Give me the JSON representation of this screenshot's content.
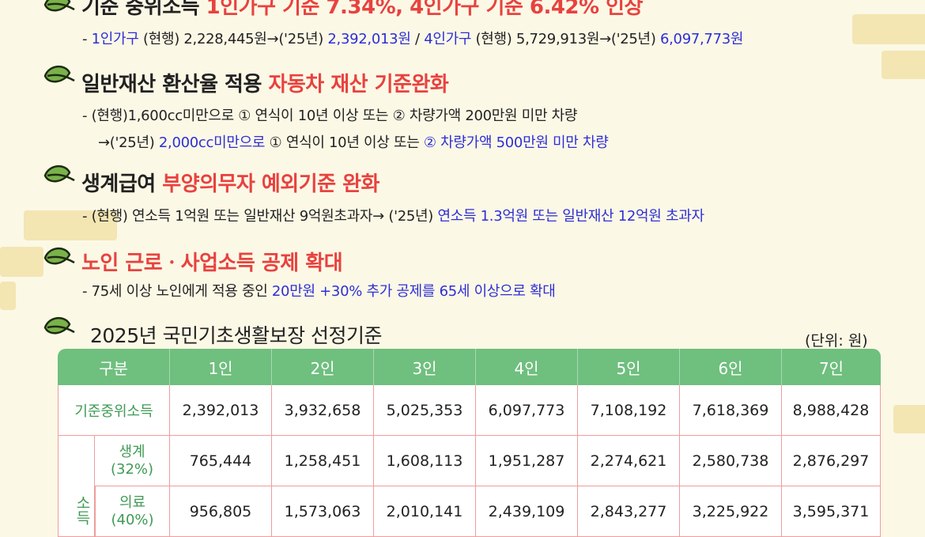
{
  "colors": {
    "red": "#e8423f",
    "blue": "#2d2fd6",
    "green": "#6fbf7e",
    "leaf": "#7ab24a"
  },
  "sec1": {
    "title": "기준 중위소득",
    "title_red": "1인가구 기준 7.34%, 4인가구 기준 6.42% 인상",
    "line": {
      "p1": "- ",
      "p2": "1인가구",
      "p3": " (현행) 2,228,445원→('25년) ",
      "p4": "2,392,013원",
      "p5": " / ",
      "p6": "4인가구",
      "p7": " (현행) 5,729,913원→('25년) ",
      "p8": "6,097,773원"
    }
  },
  "sec2": {
    "title": "일반재산 환산율 적용 ",
    "title_red": "자동차 재산 기준완화",
    "line1": "- (현행)1,600cc미만으로 ① 연식이 10년 이상 또는  ② 차량가액 200만원 미만 차량",
    "line2": {
      "p1": "→('25년) ",
      "p2": "2,000cc미만으로",
      "p3": " ① 연식이 10년 이상 또는  ",
      "p4": "② 차량가액 500만원 미만 차량"
    }
  },
  "sec3": {
    "title": "생계급여 ",
    "title_red": "부양의무자 예외기준 완화",
    "line": {
      "p1": "- (현행) 연소득 1억원 또는 일반재산 9억원초과자→ ('25년) ",
      "p2": "연소득 1.3억원 또는 일반재산 12억원 초과자"
    }
  },
  "sec4": {
    "title_red": "노인 근로ㆍ사업소득 공제 확대",
    "line": {
      "p1": "- 75세 이상 노인에게 적용 중인 ",
      "p2": "20만원 +30% 추가 공제를 65세 이상으로 확대"
    }
  },
  "sec5": {
    "title": "2025년 국민기초생활보장 선정기준",
    "unit": "(단위: 원)"
  },
  "table": {
    "headers": [
      "구분",
      "1인",
      "2인",
      "3인",
      "4인",
      "5인",
      "6인",
      "7인"
    ],
    "rows": [
      {
        "label": "기준중위소득",
        "values": [
          "2,392,013",
          "3,932,658",
          "5,025,353",
          "6,097,773",
          "7,108,192",
          "7,618,369",
          "8,988,428"
        ]
      },
      {
        "side": "소득",
        "label1": "생계",
        "label2": "(32%)",
        "values": [
          "765,444",
          "1,258,451",
          "1,608,113",
          "1,951,287",
          "2,274,621",
          "2,580,738",
          "2,876,297"
        ]
      },
      {
        "label1": "의료",
        "label2": "(40%)",
        "values": [
          "956,805",
          "1,573,063",
          "2,010,141",
          "2,439,109",
          "2,843,277",
          "3,225,922",
          "3,595,371"
        ]
      }
    ]
  }
}
